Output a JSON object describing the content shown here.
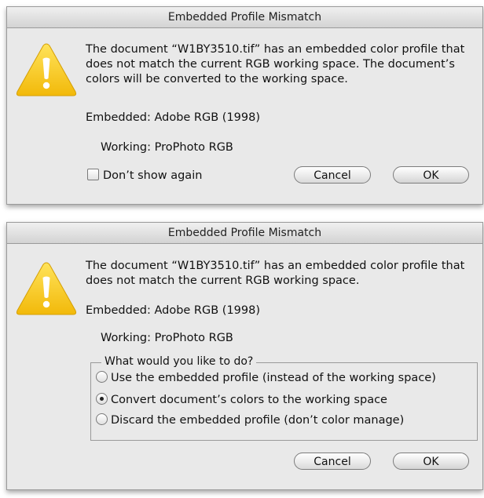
{
  "dialogs": [
    {
      "title": "Embedded Profile Mismatch",
      "message": "The document “W1BY3510.tif” has an embedded color profile that does not match the current RGB working space.  The document’s colors will be converted to the working space.",
      "embedded_label": "Embedded:",
      "embedded_value": "Adobe RGB (1998)",
      "working_label": "Working:",
      "working_value": "ProPhoto RGB",
      "checkbox_label": "Don’t show again",
      "checkbox_checked": false,
      "cancel_label": "Cancel",
      "ok_label": "OK"
    },
    {
      "title": "Embedded Profile Mismatch",
      "message": "The document “W1BY3510.tif” has an embedded color profile that does not match the current RGB working space.",
      "embedded_label": "Embedded:",
      "embedded_value": "Adobe RGB (1998)",
      "working_label": "Working:",
      "working_value": "ProPhoto RGB",
      "group_label": "What would you like to do?",
      "options": [
        {
          "label": "Use the embedded profile (instead of the working space)",
          "selected": false
        },
        {
          "label": "Convert document’s colors to the working space",
          "selected": true
        },
        {
          "label": "Discard the embedded profile (don’t color manage)",
          "selected": false
        }
      ],
      "cancel_label": "Cancel",
      "ok_label": "OK"
    }
  ],
  "icons": {
    "warning": "warning-icon"
  },
  "colors": {
    "dialog_bg": "#e9e9e9",
    "warning_yellow": "#f7cc12"
  }
}
